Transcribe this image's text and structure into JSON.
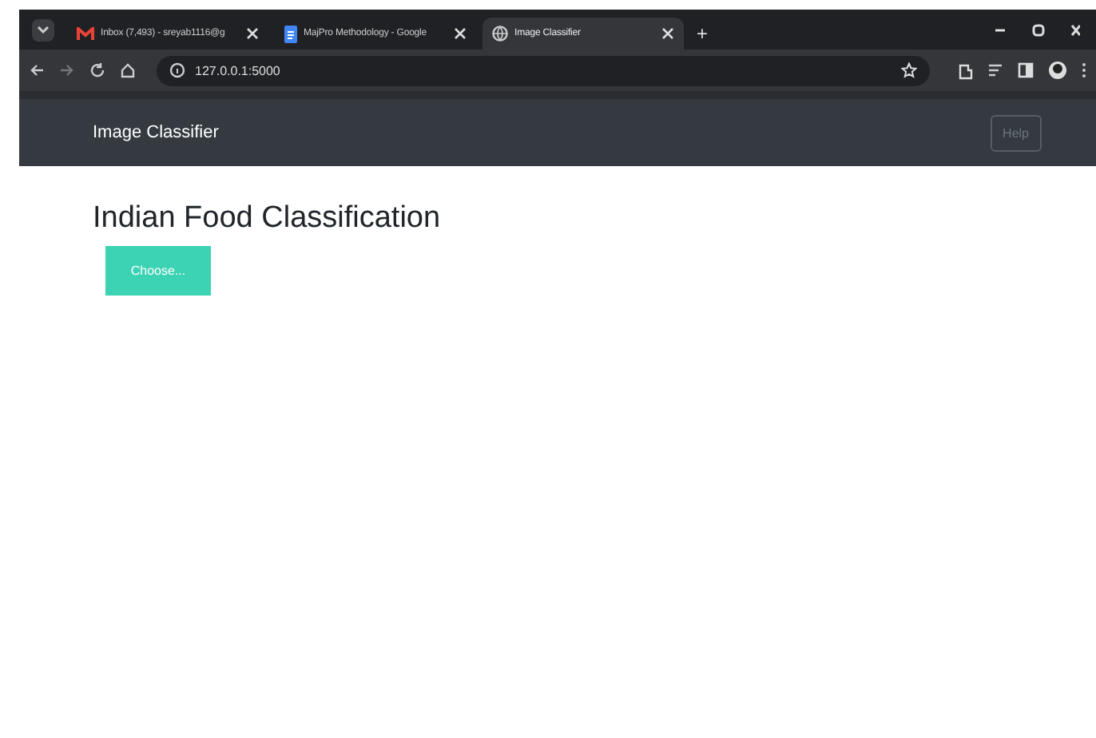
{
  "browser": {
    "tabs": [
      {
        "title": "Inbox (7,493) - sreyab1116@g",
        "selected": false,
        "kind": "mail"
      },
      {
        "title": "MajPro Methodology - Google",
        "selected": false,
        "kind": "doc"
      },
      {
        "title": "Image Classifier",
        "selected": true,
        "kind": "globe"
      }
    ],
    "new_tab": "+",
    "address": "127.0.0.1:5000"
  },
  "navbar": {
    "brand": "Image Classifier",
    "help": "Help"
  },
  "page": {
    "heading": "Indian Food Classification",
    "choose_button": "Choose..."
  }
}
